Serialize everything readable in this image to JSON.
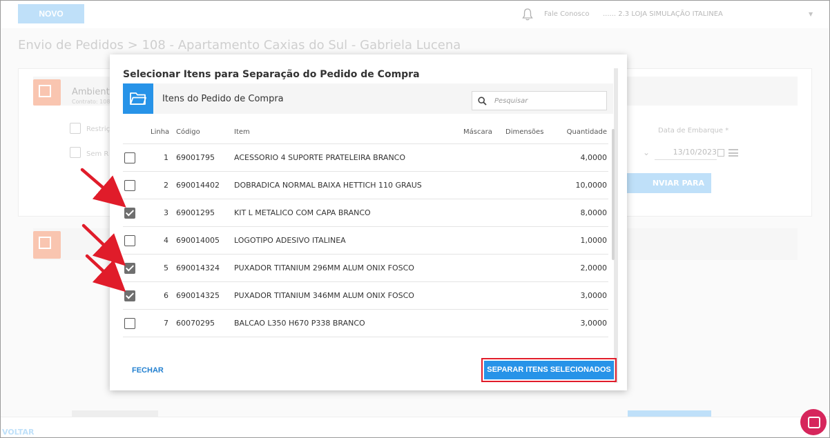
{
  "topbar": {
    "novo_label": "NOVO",
    "fale_conosco": "Fale Conosco",
    "loja": "...... 2.3 LOJA SIMULAÇÃO ITALINEA"
  },
  "page": {
    "title": "Envio de Pedidos > 108 - Apartamento Caxias do Sul - Gabriela Lucena",
    "ambiente_title": "Ambiente",
    "contrato_label": "Contrato: 108",
    "restricao_label": "Restriçõ",
    "sem_restricao_label": "Sem R",
    "data_embarque_label": "Data de Embarque *",
    "data_embarque_value": "13/10/2023",
    "enviar_label": "NVIAR PARA FÁBRICA",
    "voltar_label": "VOLTAR"
  },
  "modal": {
    "title": "Selecionar Itens para Separação do Pedido de Compra",
    "panel_title": "Itens do Pedido de Compra",
    "search_placeholder": "Pesquisar",
    "columns": {
      "linha": "Linha",
      "codigo": "Código",
      "item": "Item",
      "mascara": "Máscara",
      "dimensoes": "Dimensões",
      "quantidade": "Quantidade"
    },
    "rows": [
      {
        "checked": false,
        "linha": "1",
        "codigo": "69001795",
        "item": "ACESSORIO 4 SUPORTE PRATELEIRA BRANCO",
        "mascara": "",
        "dimensoes": "",
        "quantidade": "4,0000"
      },
      {
        "checked": false,
        "linha": "2",
        "codigo": "690014402",
        "item": "DOBRADICA NORMAL BAIXA HETTICH 110 GRAUS",
        "mascara": "",
        "dimensoes": "",
        "quantidade": "10,0000"
      },
      {
        "checked": true,
        "linha": "3",
        "codigo": "69001295",
        "item": "KIT L METALICO COM CAPA BRANCO",
        "mascara": "",
        "dimensoes": "",
        "quantidade": "8,0000"
      },
      {
        "checked": false,
        "linha": "4",
        "codigo": "690014005",
        "item": "LOGOTIPO ADESIVO ITALINEA",
        "mascara": "",
        "dimensoes": "",
        "quantidade": "1,0000"
      },
      {
        "checked": true,
        "linha": "5",
        "codigo": "690014324",
        "item": "PUXADOR TITANIUM 296MM ALUM ONIX FOSCO",
        "mascara": "",
        "dimensoes": "",
        "quantidade": "2,0000"
      },
      {
        "checked": true,
        "linha": "6",
        "codigo": "690014325",
        "item": "PUXADOR TITANIUM 346MM ALUM ONIX FOSCO",
        "mascara": "",
        "dimensoes": "",
        "quantidade": "3,0000"
      },
      {
        "checked": false,
        "linha": "7",
        "codigo": "60070295",
        "item": "BALCAO L350 H670 P338 BRANCO",
        "mascara": "",
        "dimensoes": "",
        "quantidade": "3,0000"
      }
    ],
    "fechar_label": "FECHAR",
    "separar_label": "SEPARAR ITENS SELECIONADOS"
  },
  "colors": {
    "primary": "#2793e8",
    "link": "#2380d0",
    "highlight_border": "#e01c2a",
    "annotation_arrow": "#e01c2a",
    "chat": "#d6265c"
  },
  "icons": [
    "bell-icon",
    "box-icon",
    "folder-icon",
    "search-icon",
    "calendar-icon",
    "list-icon",
    "chat-icon",
    "checkbox-checked-icon",
    "checkbox-empty-icon",
    "red-arrow-annotation"
  ]
}
